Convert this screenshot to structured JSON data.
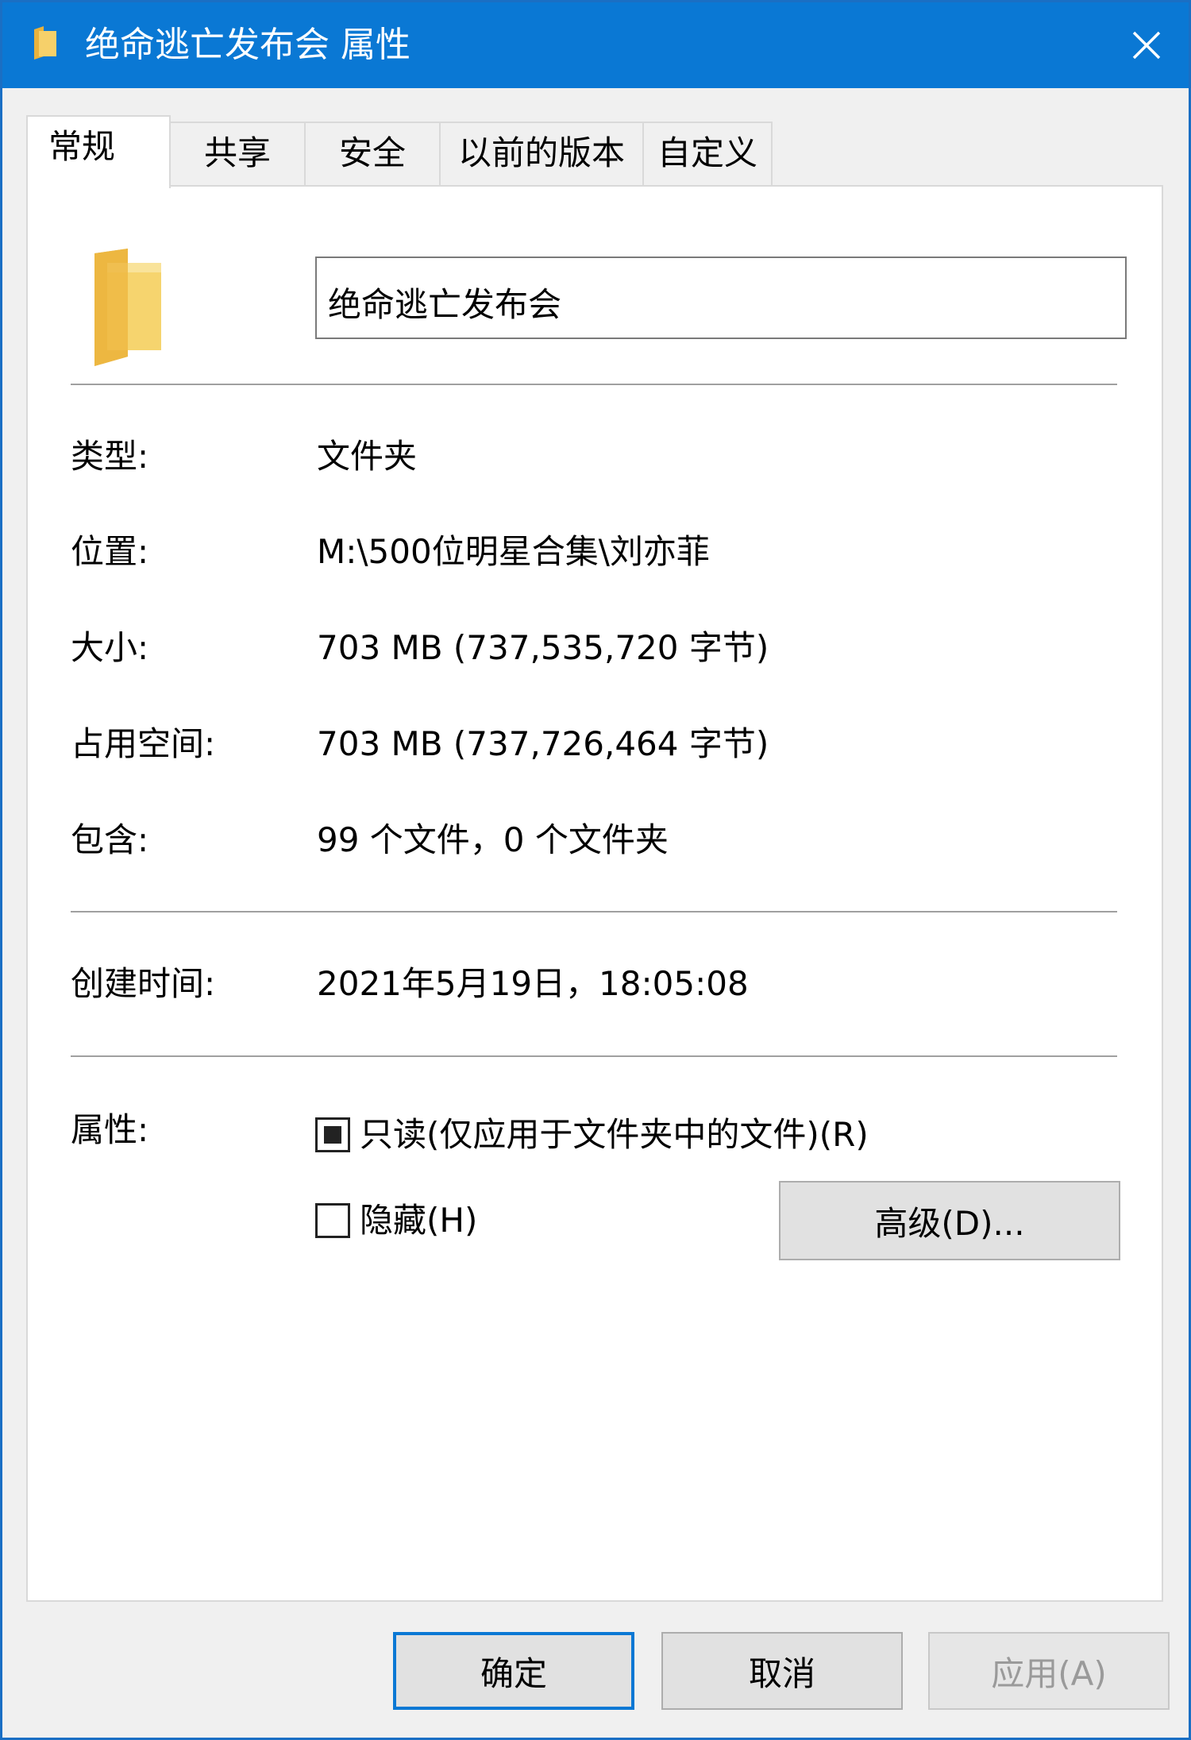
{
  "window": {
    "title": "绝命逃亡发布会 属性"
  },
  "tabs": [
    {
      "label": "常规",
      "active": true
    },
    {
      "label": "共享",
      "active": false
    },
    {
      "label": "安全",
      "active": false
    },
    {
      "label": "以前的版本",
      "active": false
    },
    {
      "label": "自定义",
      "active": false
    }
  ],
  "general": {
    "name_value": "绝命逃亡发布会",
    "rows": [
      {
        "label": "类型:",
        "value": "文件夹"
      },
      {
        "label": "位置:",
        "value": "M:\\500位明星合集\\刘亦菲"
      },
      {
        "label": "大小:",
        "value": "703 MB (737,535,720 字节)"
      },
      {
        "label": "占用空间:",
        "value": "703 MB (737,726,464 字节)"
      },
      {
        "label": "包含:",
        "value": "99 个文件，0 个文件夹"
      }
    ],
    "created_label": "创建时间:",
    "created_value": "2021年5月19日，18:05:08",
    "attributes_label": "属性:",
    "readonly_label": "只读(仅应用于文件夹中的文件)(R)",
    "readonly_state": "indeterminate",
    "hidden_label": "隐藏(H)",
    "hidden_checked": false,
    "advanced_button": "高级(D)..."
  },
  "footer": {
    "ok": "确定",
    "cancel": "取消",
    "apply": "应用(A)"
  },
  "icons": {
    "title": "folder-icon",
    "close": "close-icon",
    "big_folder": "folder-icon"
  },
  "colors": {
    "titlebar": "#0a78d4",
    "folder": "#f3c758"
  }
}
